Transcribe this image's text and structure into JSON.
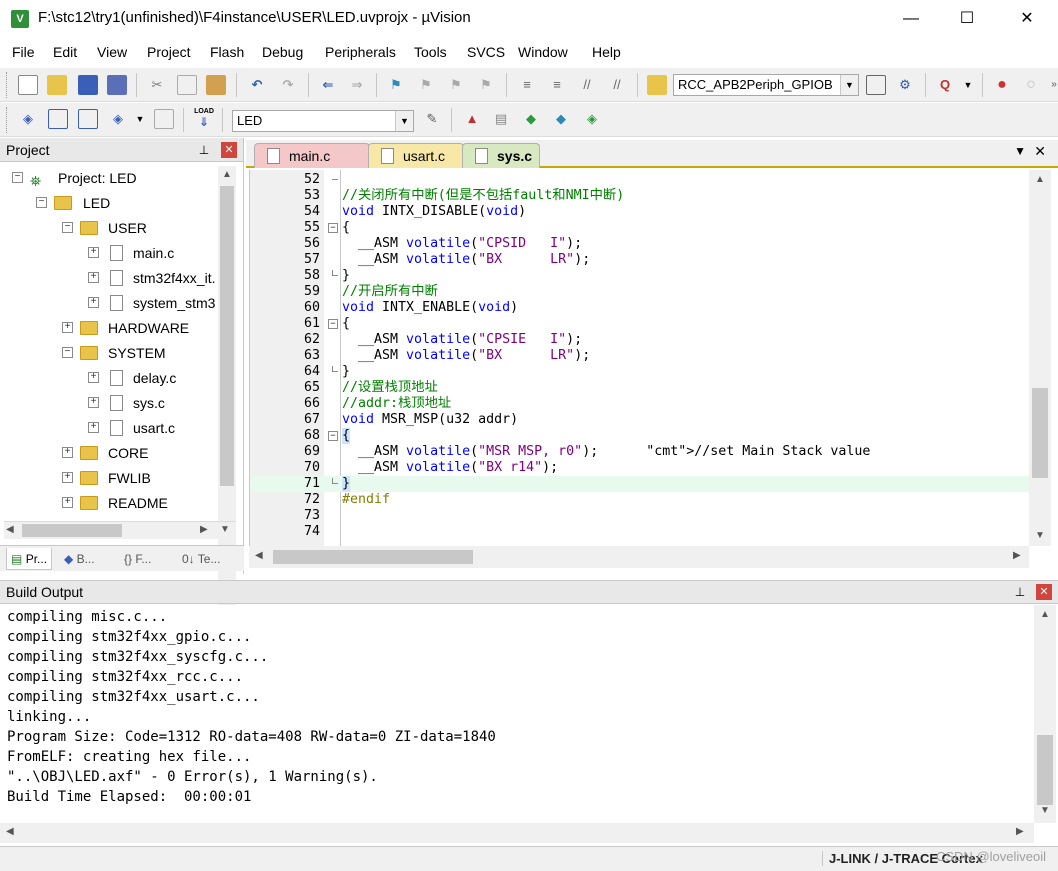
{
  "window": {
    "title": "F:\\stc12\\try1(unfinished)\\F4instance\\USER\\LED.uvprojx - µVision",
    "minimize": "—",
    "maximize": "☐",
    "close": "✕"
  },
  "menu": [
    "File",
    "Edit",
    "View",
    "Project",
    "Flash",
    "Debug",
    "Peripherals",
    "Tools",
    "SVCS",
    "Window",
    "Help"
  ],
  "toolbar1": {
    "find_combo": "RCC_APB2Periph_GPIOB"
  },
  "toolbar2": {
    "target_combo": "LED",
    "load_label": "LOAD"
  },
  "project_pane": {
    "title": "Project",
    "pin": "📌",
    "close": "✕",
    "tree": [
      {
        "label": "Project: LED"
      },
      {
        "label": "LED"
      },
      {
        "label": "USER"
      },
      {
        "label": "main.c"
      },
      {
        "label": "stm32f4xx_it."
      },
      {
        "label": "system_stm3"
      },
      {
        "label": "HARDWARE"
      },
      {
        "label": "SYSTEM"
      },
      {
        "label": "delay.c"
      },
      {
        "label": "sys.c"
      },
      {
        "label": "usart.c"
      },
      {
        "label": "CORE"
      },
      {
        "label": "FWLIB"
      },
      {
        "label": "README"
      }
    ],
    "tabs": [
      "Pr...",
      "B...",
      "{} F...",
      "0↓ Te..."
    ]
  },
  "editor": {
    "tabs": [
      "main.c",
      "usart.c",
      "sys.c"
    ],
    "active_tab": "sys.c",
    "lines": [
      {
        "n": "52",
        "text": ""
      },
      {
        "n": "53",
        "text": "//关闭所有中断(但是不包括fault和NMI中断)"
      },
      {
        "n": "54",
        "text": "void INTX_DISABLE(void)"
      },
      {
        "n": "55",
        "text": "{"
      },
      {
        "n": "56",
        "text": "  __ASM volatile(\"CPSID   I\");"
      },
      {
        "n": "57",
        "text": "  __ASM volatile(\"BX      LR\");"
      },
      {
        "n": "58",
        "text": "}"
      },
      {
        "n": "59",
        "text": "//开启所有中断"
      },
      {
        "n": "60",
        "text": "void INTX_ENABLE(void)"
      },
      {
        "n": "61",
        "text": "{"
      },
      {
        "n": "62",
        "text": "  __ASM volatile(\"CPSIE   I\");"
      },
      {
        "n": "63",
        "text": "  __ASM volatile(\"BX      LR\");"
      },
      {
        "n": "64",
        "text": "}"
      },
      {
        "n": "65",
        "text": "//设置栈顶地址"
      },
      {
        "n": "66",
        "text": "//addr:栈顶地址"
      },
      {
        "n": "67",
        "text": "void MSR_MSP(u32 addr)"
      },
      {
        "n": "68",
        "text": "{"
      },
      {
        "n": "69",
        "text": "  __ASM volatile(\"MSR MSP, r0\");      //set Main Stack value"
      },
      {
        "n": "70",
        "text": "  __ASM volatile(\"BX r14\");"
      },
      {
        "n": "71",
        "text": "}"
      },
      {
        "n": "72",
        "text": "#endif"
      },
      {
        "n": "73",
        "text": ""
      },
      {
        "n": "74",
        "text": ""
      }
    ],
    "active_line": "71"
  },
  "build_output": {
    "title": "Build Output",
    "lines": [
      "compiling misc.c...",
      "compiling stm32f4xx_gpio.c...",
      "compiling stm32f4xx_syscfg.c...",
      "compiling stm32f4xx_rcc.c...",
      "compiling stm32f4xx_usart.c...",
      "linking...",
      "Program Size: Code=1312 RO-data=408 RW-data=0 ZI-data=1840",
      "FromELF: creating hex file...",
      "\"..\\OBJ\\LED.axf\" - 0 Error(s), 1 Warning(s).",
      "Build Time Elapsed:  00:00:01"
    ]
  },
  "status": {
    "debugger": "J-LINK / J-TRACE Cortex",
    "watermark": "CSDN @loveliveoil"
  }
}
